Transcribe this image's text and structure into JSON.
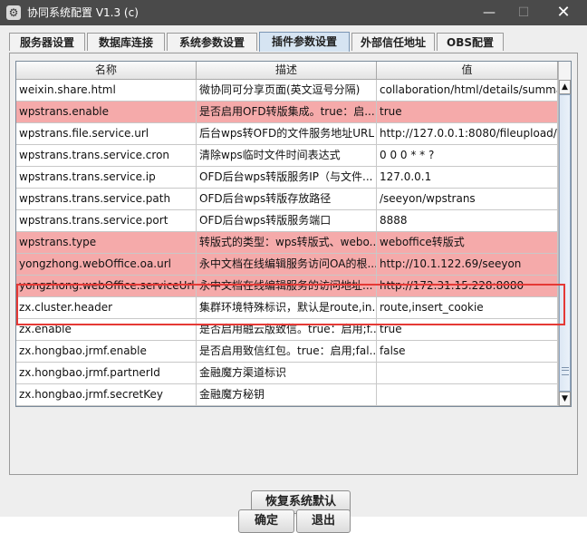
{
  "window": {
    "title": "协同系统配置 V1.3 (c)",
    "icon": "gear-window-icon",
    "minimize": "—",
    "maximize": "☐",
    "close": "✕"
  },
  "tabs": [
    {
      "label": "服务器设置",
      "active": false
    },
    {
      "label": "数据库连接",
      "active": false
    },
    {
      "label": "系统参数设置",
      "active": false
    },
    {
      "label": "插件参数设置",
      "active": true
    },
    {
      "label": "外部信任地址",
      "active": false
    },
    {
      "label": "OBS配置",
      "active": false
    }
  ],
  "table": {
    "columns": [
      "名称",
      "描述",
      "值"
    ],
    "rows": [
      {
        "name": "weixin.share.html",
        "desc": "微协同可分享页面(英文逗号分隔)",
        "value": "collaboration/html/details/summary",
        "highlight": false
      },
      {
        "name": "wpstrans.enable",
        "desc": "是否启用OFD转版集成。true：启...",
        "value": "true",
        "highlight": true
      },
      {
        "name": "wpstrans.file.service.url",
        "desc": "后台wps转OFD的文件服务地址URL",
        "value": "http://127.0.0.1:8080/fileupload/se...",
        "highlight": false
      },
      {
        "name": "wpstrans.trans.service.cron",
        "desc": "清除wps临时文件时间表达式",
        "value": "0 0 0 * * ?",
        "highlight": false
      },
      {
        "name": "wpstrans.trans.service.ip",
        "desc": "OFD后台wps转版服务IP（与文件...",
        "value": "127.0.0.1",
        "highlight": false
      },
      {
        "name": "wpstrans.trans.service.path",
        "desc": "OFD后台wps转版存放路径",
        "value": "/seeyon/wpstrans",
        "highlight": false
      },
      {
        "name": "wpstrans.trans.service.port",
        "desc": "OFD后台wps转版服务端口",
        "value": "8888",
        "highlight": false
      },
      {
        "name": "wpstrans.type",
        "desc": "转版式的类型：wps转版式、webo...",
        "value": "weboffice转版式",
        "highlight": true
      },
      {
        "name": "yongzhong.webOffice.oa.url",
        "desc": "永中文档在线编辑服务访问OA的根...",
        "value": "http://10.1.122.69/seeyon",
        "highlight": true
      },
      {
        "name": "yongzhong.webOffice.serviceUrl",
        "desc": "永中文档在线编辑服务的访问地址...",
        "value": "http://172.31.15.228:8080",
        "highlight": true
      },
      {
        "name": "zx.cluster.header",
        "desc": "集群环境特殊标识，默认是route,in...",
        "value": "route,insert_cookie",
        "highlight": false
      },
      {
        "name": "zx.enable",
        "desc": "是否启用融云版致信。true：启用;f...",
        "value": "true",
        "highlight": false
      },
      {
        "name": "zx.hongbao.jrmf.enable",
        "desc": "是否启用致信红包。true：启用;fal...",
        "value": "false",
        "highlight": false
      },
      {
        "name": "zx.hongbao.jrmf.partnerId",
        "desc": "金融魔方渠道标识",
        "value": "",
        "highlight": false
      },
      {
        "name": "zx.hongbao.jrmf.secretKey",
        "desc": "金融魔方秘钥",
        "value": "",
        "highlight": false
      }
    ]
  },
  "scrollbar": {
    "up_arrow": "▲",
    "down_arrow": "▼"
  },
  "buttons": {
    "restore_default": "恢复系统默认",
    "confirm": "确定",
    "exit": "退出"
  },
  "colors": {
    "highlight_row": "#f5aaaa",
    "annotation_box": "#e53935",
    "active_tab": "#d6e4f2"
  }
}
